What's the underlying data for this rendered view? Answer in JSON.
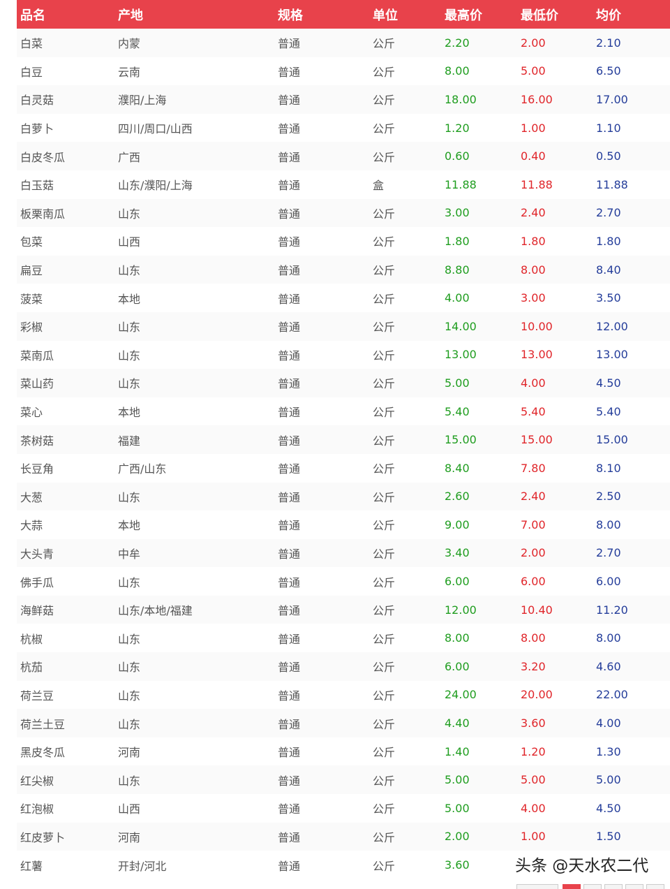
{
  "table": {
    "headers": {
      "name": "品名",
      "origin": "产地",
      "spec": "规格",
      "unit": "单位",
      "max": "最高价",
      "min": "最低价",
      "avg": "均价"
    },
    "rows": [
      {
        "name": "白菜",
        "origin": "内蒙",
        "spec": "普通",
        "unit": "公斤",
        "max": "2.20",
        "min": "2.00",
        "avg": "2.10"
      },
      {
        "name": "白豆",
        "origin": "云南",
        "spec": "普通",
        "unit": "公斤",
        "max": "8.00",
        "min": "5.00",
        "avg": "6.50"
      },
      {
        "name": "白灵菇",
        "origin": "濮阳/上海",
        "spec": "普通",
        "unit": "公斤",
        "max": "18.00",
        "min": "16.00",
        "avg": "17.00"
      },
      {
        "name": "白萝卜",
        "origin": "四川/周口/山西",
        "spec": "普通",
        "unit": "公斤",
        "max": "1.20",
        "min": "1.00",
        "avg": "1.10"
      },
      {
        "name": "白皮冬瓜",
        "origin": "广西",
        "spec": "普通",
        "unit": "公斤",
        "max": "0.60",
        "min": "0.40",
        "avg": "0.50"
      },
      {
        "name": "白玉菇",
        "origin": "山东/濮阳/上海",
        "spec": "普通",
        "unit": "盒",
        "max": "11.88",
        "min": "11.88",
        "avg": "11.88"
      },
      {
        "name": "板栗南瓜",
        "origin": "山东",
        "spec": "普通",
        "unit": "公斤",
        "max": "3.00",
        "min": "2.40",
        "avg": "2.70"
      },
      {
        "name": "包菜",
        "origin": "山西",
        "spec": "普通",
        "unit": "公斤",
        "max": "1.80",
        "min": "1.80",
        "avg": "1.80"
      },
      {
        "name": "扁豆",
        "origin": "山东",
        "spec": "普通",
        "unit": "公斤",
        "max": "8.80",
        "min": "8.00",
        "avg": "8.40"
      },
      {
        "name": "菠菜",
        "origin": "本地",
        "spec": "普通",
        "unit": "公斤",
        "max": "4.00",
        "min": "3.00",
        "avg": "3.50"
      },
      {
        "name": "彩椒",
        "origin": "山东",
        "spec": "普通",
        "unit": "公斤",
        "max": "14.00",
        "min": "10.00",
        "avg": "12.00"
      },
      {
        "name": "菜南瓜",
        "origin": "山东",
        "spec": "普通",
        "unit": "公斤",
        "max": "13.00",
        "min": "13.00",
        "avg": "13.00"
      },
      {
        "name": "菜山药",
        "origin": "山东",
        "spec": "普通",
        "unit": "公斤",
        "max": "5.00",
        "min": "4.00",
        "avg": "4.50"
      },
      {
        "name": "菜心",
        "origin": "本地",
        "spec": "普通",
        "unit": "公斤",
        "max": "5.40",
        "min": "5.40",
        "avg": "5.40"
      },
      {
        "name": "茶树菇",
        "origin": "福建",
        "spec": "普通",
        "unit": "公斤",
        "max": "15.00",
        "min": "15.00",
        "avg": "15.00"
      },
      {
        "name": "长豆角",
        "origin": "广西/山东",
        "spec": "普通",
        "unit": "公斤",
        "max": "8.40",
        "min": "7.80",
        "avg": "8.10"
      },
      {
        "name": "大葱",
        "origin": "山东",
        "spec": "普通",
        "unit": "公斤",
        "max": "2.60",
        "min": "2.40",
        "avg": "2.50"
      },
      {
        "name": "大蒜",
        "origin": "本地",
        "spec": "普通",
        "unit": "公斤",
        "max": "9.00",
        "min": "7.00",
        "avg": "8.00"
      },
      {
        "name": "大头青",
        "origin": "中牟",
        "spec": "普通",
        "unit": "公斤",
        "max": "3.40",
        "min": "2.00",
        "avg": "2.70"
      },
      {
        "name": "佛手瓜",
        "origin": "山东",
        "spec": "普通",
        "unit": "公斤",
        "max": "6.00",
        "min": "6.00",
        "avg": "6.00"
      },
      {
        "name": "海鲜菇",
        "origin": "山东/本地/福建",
        "spec": "普通",
        "unit": "公斤",
        "max": "12.00",
        "min": "10.40",
        "avg": "11.20"
      },
      {
        "name": "杭椒",
        "origin": "山东",
        "spec": "普通",
        "unit": "公斤",
        "max": "8.00",
        "min": "8.00",
        "avg": "8.00"
      },
      {
        "name": "杭茄",
        "origin": "山东",
        "spec": "普通",
        "unit": "公斤",
        "max": "6.00",
        "min": "3.20",
        "avg": "4.60"
      },
      {
        "name": "荷兰豆",
        "origin": "山东",
        "spec": "普通",
        "unit": "公斤",
        "max": "24.00",
        "min": "20.00",
        "avg": "22.00"
      },
      {
        "name": "荷兰土豆",
        "origin": "山东",
        "spec": "普通",
        "unit": "公斤",
        "max": "4.40",
        "min": "3.60",
        "avg": "4.00"
      },
      {
        "name": "黑皮冬瓜",
        "origin": "河南",
        "spec": "普通",
        "unit": "公斤",
        "max": "1.40",
        "min": "1.20",
        "avg": "1.30"
      },
      {
        "name": "红尖椒",
        "origin": "山东",
        "spec": "普通",
        "unit": "公斤",
        "max": "5.00",
        "min": "5.00",
        "avg": "5.00"
      },
      {
        "name": "红泡椒",
        "origin": "山西",
        "spec": "普通",
        "unit": "公斤",
        "max": "5.00",
        "min": "4.00",
        "avg": "4.50"
      },
      {
        "name": "红皮萝卜",
        "origin": "河南",
        "spec": "普通",
        "unit": "公斤",
        "max": "2.00",
        "min": "1.00",
        "avg": "1.50"
      },
      {
        "name": "红薯",
        "origin": "开封/河北",
        "spec": "普通",
        "unit": "公斤",
        "max": "3.60",
        "min": "",
        "avg": ""
      }
    ]
  },
  "watermark": "头条 @天水农二代",
  "colors": {
    "header_bg": "#e8424b",
    "max_price": "#1f9d1f",
    "min_price": "#e0252a",
    "avg_price": "#243d9a"
  }
}
